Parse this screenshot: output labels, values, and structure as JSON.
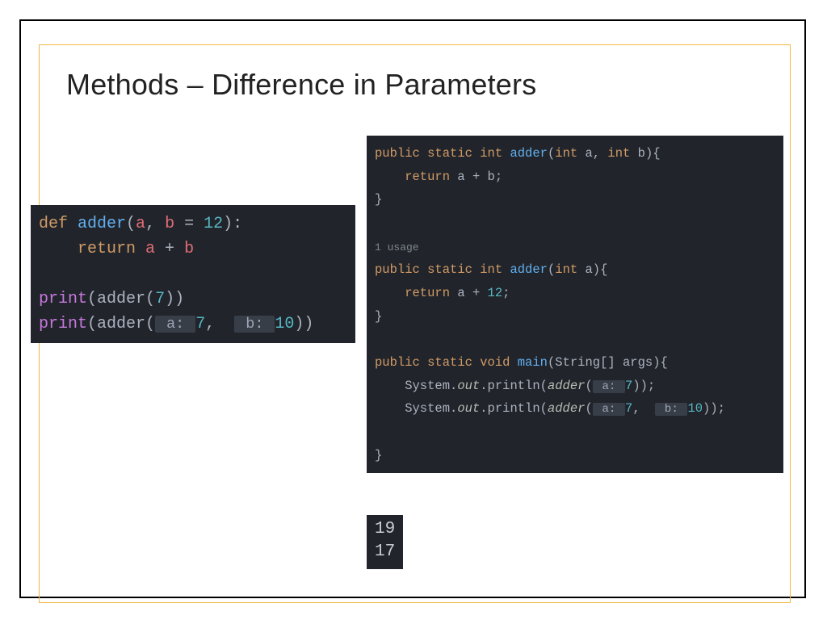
{
  "title": "Methods – Difference in Parameters",
  "python": {
    "l1_def": "def ",
    "l1_name": "adder",
    "l1_paren_open": "(",
    "l1_a": "a",
    "l1_comma": ", ",
    "l1_b": "b ",
    "l1_eq": "= ",
    "l1_twelve": "12",
    "l1_paren_close": "):",
    "l2_return": "    return ",
    "l2_a": "a ",
    "l2_plus": "+ ",
    "l2_b": "b",
    "l4_print": "print",
    "l4_open": "(",
    "l4_adder": "adder",
    "l4_open2": "(",
    "l4_seven": "7",
    "l4_close": "))",
    "l5_print": "print",
    "l5_open": "(",
    "l5_adder": "adder",
    "l5_open2": "(",
    "l5_hint_a": " a: ",
    "l5_seven": "7",
    "l5_comma": ",  ",
    "l5_hint_b": " b: ",
    "l5_ten": "10",
    "l5_close": "))"
  },
  "java": {
    "l1_mod": "public static int ",
    "l1_name": "adder",
    "l1_sig_open": "(",
    "l1_int1": "int ",
    "l1_a": "a",
    "l1_c1": ", ",
    "l1_int2": "int ",
    "l1_b": "b",
    "l1_sig_close": "){",
    "l2_return": "    return ",
    "l2_a": "a ",
    "l2_plus": "+ ",
    "l2_b": "b",
    "l2_semi": ";",
    "l3_close": "}",
    "usage": "1 usage",
    "l5_mod": "public static int ",
    "l5_name": "adder",
    "l5_sig_open": "(",
    "l5_int": "int ",
    "l5_a": "a",
    "l5_sig_close": "){",
    "l6_return": "    return ",
    "l6_a": "a ",
    "l6_plus": "+ ",
    "l6_twelve": "12",
    "l6_semi": ";",
    "l7_close": "}",
    "l9_mod": "public static void ",
    "l9_name": "main",
    "l9_sig_open": "(",
    "l9_type": "String[] ",
    "l9_args": "args",
    "l9_sig_close": "){",
    "l10_sys": "    System.",
    "l10_out": "out",
    "l10_pr": ".println(",
    "l10_adder": "adder",
    "l10_open": "(",
    "l10_hint_a": " a: ",
    "l10_seven": "7",
    "l10_close": "));",
    "l11_sys": "    System.",
    "l11_out": "out",
    "l11_pr": ".println(",
    "l11_adder": "adder",
    "l11_open": "(",
    "l11_hint_a": " a: ",
    "l11_seven": "7",
    "l11_c": ",  ",
    "l11_hint_b": " b: ",
    "l11_ten": "10",
    "l11_close": "));",
    "l13_close": "}"
  },
  "output": {
    "line1": "19",
    "line2": "17"
  }
}
